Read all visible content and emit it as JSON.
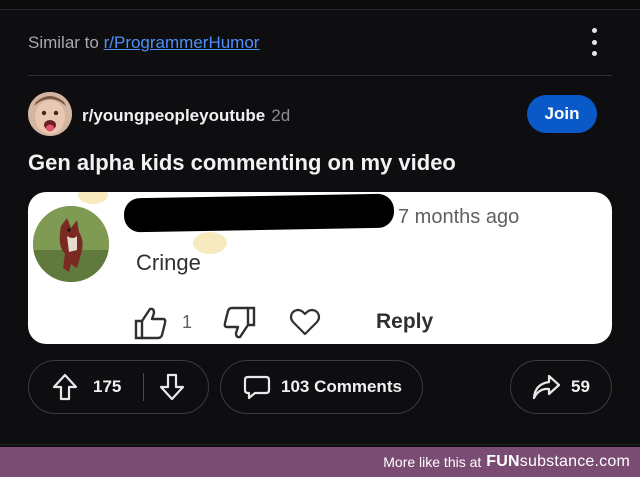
{
  "header": {
    "similar_prefix": "Similar to",
    "similar_link": "r/ProgrammerHumor"
  },
  "post": {
    "subreddit": "r/youngpeopleyoutube",
    "age": "2d",
    "join_label": "Join",
    "title": "Gen alpha kids commenting on my video"
  },
  "embedded_comment": {
    "timestamp": "7 months ago",
    "text": "Cringe",
    "likes": "1",
    "reply_label": "Reply"
  },
  "actions": {
    "upvotes": "175",
    "comments_label": "103 Comments",
    "shares": "59"
  },
  "footer": {
    "prefix": "More like this at",
    "brand_bold": "FUN",
    "brand_rest": "substance.com"
  },
  "colors": {
    "background": "#0e0e10",
    "join_button": "#0a59c8",
    "link": "#4f8ff7",
    "footer_bar": "#7a4c73"
  }
}
